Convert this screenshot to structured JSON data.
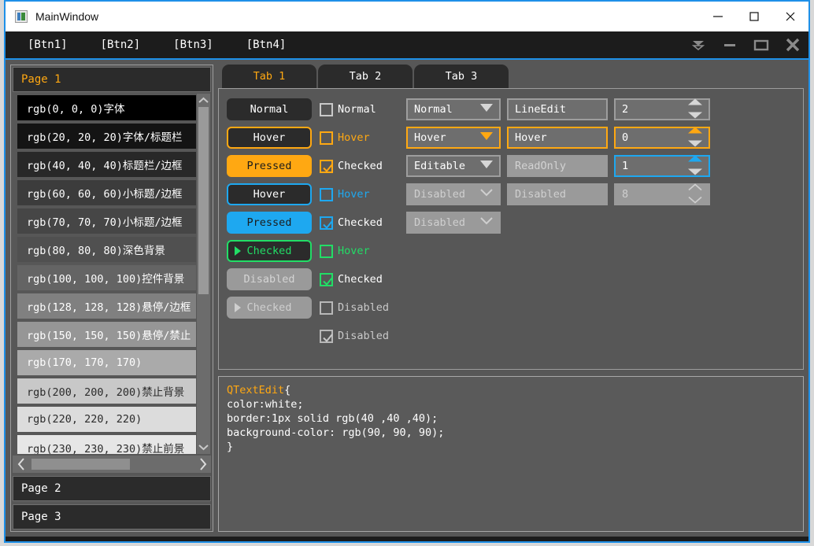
{
  "titlebar": {
    "title": "MainWindow",
    "icon": "app-icon",
    "minimize": "minimize-icon",
    "maximize": "maximize-icon",
    "close": "close-icon"
  },
  "toolbar": {
    "buttons": [
      "[Btn1]",
      "[Btn2]",
      "[Btn3]",
      "[Btn4]"
    ],
    "icons": [
      "collapse-icon",
      "minimize-icon",
      "restore-icon",
      "close-icon"
    ]
  },
  "toolbox": {
    "pages": [
      {
        "label": "Page 1",
        "active": true
      },
      {
        "label": "Page 2",
        "active": false
      },
      {
        "label": "Page 3",
        "active": false
      }
    ],
    "items": [
      {
        "label": "rgb(0,  0,  0)字体",
        "bg": "#000000",
        "fg": "#ffffff"
      },
      {
        "label": "rgb(20,  20,  20)字体/标题栏",
        "bg": "#141414",
        "fg": "#ffffff"
      },
      {
        "label": "rgb(40,  40,  40)标题栏/边框",
        "bg": "#282828",
        "fg": "#ffffff"
      },
      {
        "label": "rgb(60,  60,  60)小标题/边框",
        "bg": "#3c3c3c",
        "fg": "#ffffff"
      },
      {
        "label": "rgb(70,  70,  70)小标题/边框",
        "bg": "#464646",
        "fg": "#ffffff"
      },
      {
        "label": "rgb(80,  80,  80)深色背景",
        "bg": "#505050",
        "fg": "#ffffff"
      },
      {
        "label": "rgb(100, 100, 100)控件背景",
        "bg": "#646464",
        "fg": "#ffffff"
      },
      {
        "label": "rgb(128, 128, 128)悬停/边框",
        "bg": "#808080",
        "fg": "#ffffff"
      },
      {
        "label": "rgb(150, 150, 150)悬停/禁止",
        "bg": "#969696",
        "fg": "#ffffff"
      },
      {
        "label": "rgb(170, 170, 170)",
        "bg": "#aaaaaa",
        "fg": "#ffffff"
      },
      {
        "label": "rgb(200, 200, 200)禁止背景",
        "bg": "#c8c8c8",
        "fg": "#2b2b2b"
      },
      {
        "label": "rgb(220, 220, 220)",
        "bg": "#dcdcdc",
        "fg": "#2b2b2b"
      },
      {
        "label": "rgb(230, 230, 230)禁止前景",
        "bg": "#e6e6e6",
        "fg": "#2b2b2b"
      }
    ],
    "scrollbar": {
      "up": "chevron-up-icon",
      "down": "chevron-down-icon",
      "left": "chevron-left-icon",
      "right": "chevron-right-icon"
    }
  },
  "tabs": [
    {
      "label": "Tab 1",
      "active": true
    },
    {
      "label": "Tab 2",
      "active": false
    },
    {
      "label": "Tab 3",
      "active": false
    }
  ],
  "buttons": [
    {
      "label": "Normal",
      "state": "normal"
    },
    {
      "label": "Hover",
      "state": "hoverO"
    },
    {
      "label": "Pressed",
      "state": "pressO"
    },
    {
      "label": "Hover",
      "state": "hoverB"
    },
    {
      "label": "Pressed",
      "state": "pressB"
    },
    {
      "label": "Checked",
      "state": "checkG",
      "arrow": true
    },
    {
      "label": "Disabled",
      "state": "disabled"
    },
    {
      "label": "Checked",
      "state": "discheck",
      "arrow": true
    }
  ],
  "checkboxes": [
    {
      "label": "Normal",
      "checked": false,
      "variant": "plain"
    },
    {
      "label": "Hover",
      "checked": false,
      "variant": "o"
    },
    {
      "label": "Checked",
      "checked": true,
      "variant": "o"
    },
    {
      "label": "Hover",
      "checked": false,
      "variant": "b"
    },
    {
      "label": "Checked",
      "checked": true,
      "variant": "b"
    },
    {
      "label": "Hover",
      "checked": false,
      "variant": "g"
    },
    {
      "label": "Checked",
      "checked": true,
      "variant": "g"
    },
    {
      "label": "Disabled",
      "checked": false,
      "variant": "d"
    },
    {
      "label": "Disabled",
      "checked": true,
      "variant": "d"
    }
  ],
  "combos": [
    {
      "value": "Normal",
      "state": "normal"
    },
    {
      "value": "Hover",
      "state": "hover"
    },
    {
      "value": "Editable",
      "state": "normal"
    },
    {
      "value": "Disabled",
      "state": "disabled"
    },
    {
      "value": "Disabled",
      "state": "disabled"
    }
  ],
  "lineedits": [
    {
      "value": "LineEdit",
      "state": "normal"
    },
    {
      "value": "Hover",
      "state": "hover"
    },
    {
      "value": "ReadOnly",
      "state": "readonly"
    },
    {
      "value": "Disabled",
      "state": "disabled"
    }
  ],
  "spinboxes": [
    {
      "value": "2",
      "state": "normal"
    },
    {
      "value": "0",
      "state": "hover"
    },
    {
      "value": "1",
      "state": "focus"
    },
    {
      "value": "8",
      "state": "disabled"
    }
  ],
  "textedit": {
    "selector": "QTextEdit",
    "lines": [
      "{",
      "color:white;",
      "border:1px solid rgb(40 ,40 ,40);",
      "background-color: rgb(90, 90, 90);",
      "}"
    ]
  },
  "colors": {
    "accent_orange": "#ffa812",
    "accent_blue": "#1ea8f0",
    "accent_green": "#22dd66",
    "window_bg": "#575757",
    "dark_bg": "#2b2b2b",
    "frame_border": "#1e90e8"
  }
}
